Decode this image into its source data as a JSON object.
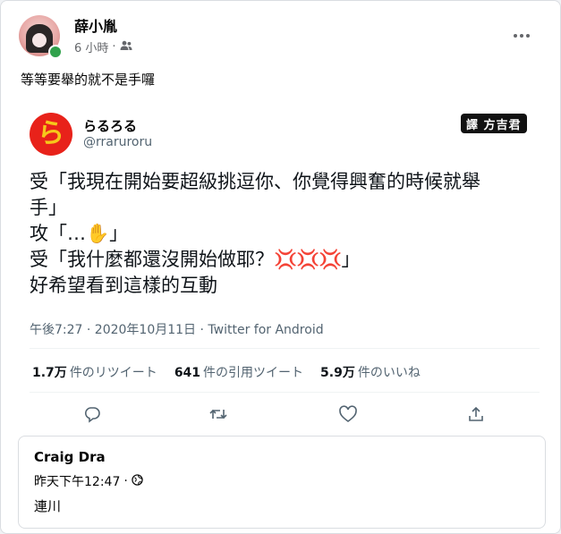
{
  "post": {
    "author": "薛小胤",
    "time": "6 小時",
    "separator": "·",
    "text": "等等要舉的就不是手囉"
  },
  "tweet": {
    "display_name": "らるろる",
    "handle": "@rraruroru",
    "watermark": "譯 方吉君",
    "logo_glyph": "ら",
    "lines": [
      "受「我現在開始要超級挑逗你、你覺得興奮的時候就舉",
      "手」",
      "攻「…",
      "」",
      "受「我什麼都還沒開始做耶？",
      "」",
      "好希望看到這樣的互動"
    ],
    "emoji_hand": "✋",
    "emoji_anger": "💢💢💢",
    "timestamp": "午後7:27 · 2020年10月11日 · Twitter for Android",
    "stats": {
      "retweets_count": "1.7万",
      "retweets_label": "件のリツイート",
      "quotes_count": "641",
      "quotes_label": "件の引用ツイート",
      "likes_count": "5.9万",
      "likes_label": "件のいいね"
    },
    "actions": [
      "reply-icon",
      "retweet-icon",
      "like-icon",
      "share-icon"
    ]
  },
  "comment": {
    "author": "Craig Dra",
    "time": "昨天下午12:47",
    "separator": "·",
    "text": "連川"
  },
  "colors": {
    "online": "#31a24c",
    "tweet_logo_bg": "#e8221a",
    "tweet_logo_fg": "#f6c81a",
    "secondary_text": "#65676b",
    "tweet_secondary": "#536471"
  }
}
